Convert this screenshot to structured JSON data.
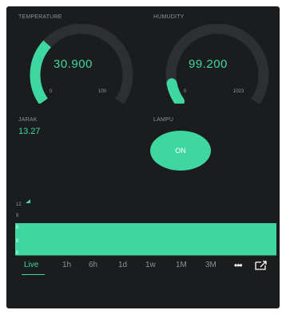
{
  "colors": {
    "background": "#1b1c1e",
    "accent": "#3fd7a1",
    "track": "#2e2f31",
    "label": "#8d9093"
  },
  "temperature": {
    "label": "TEMPERATURE",
    "value": "30.900",
    "min": "0",
    "max": "100",
    "fill_fraction": 0.309
  },
  "humidity": {
    "label": "HUMUDITY",
    "value": "99.200",
    "min": "0",
    "max": "1023",
    "fill_fraction": 0.097
  },
  "jarak": {
    "label": "JARAK",
    "value": "13.27"
  },
  "lampu": {
    "label": "LAMPU",
    "button_label": "ON"
  },
  "chart": {
    "yticks": [
      "12",
      "9"
    ],
    "bar_markers": [
      "0",
      "0",
      "0"
    ]
  },
  "time_tabs": {
    "selected": "Live",
    "items": [
      "Live",
      "1h",
      "6h",
      "1d",
      "1w",
      "1M",
      "3M"
    ],
    "more_icon": "more-horizontal-icon",
    "export_icon": "export-icon"
  }
}
